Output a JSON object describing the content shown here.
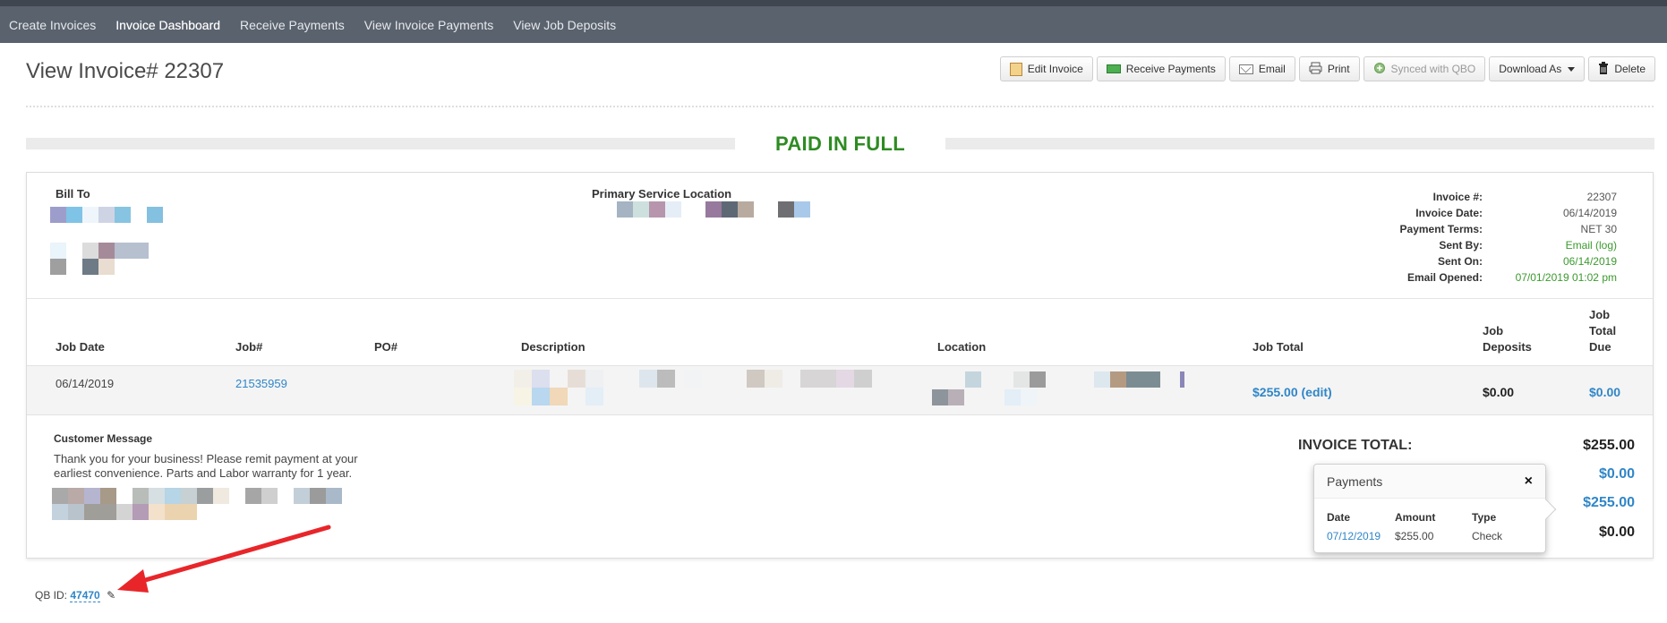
{
  "nav": {
    "items": [
      "Create Invoices",
      "Invoice Dashboard",
      "Receive Payments",
      "View Invoice Payments",
      "View Job Deposits"
    ],
    "active": "Invoice Dashboard"
  },
  "page": {
    "title": "View Invoice# 22307"
  },
  "toolbar": {
    "edit_invoice": "Edit Invoice",
    "receive_payments": "Receive Payments",
    "email": "Email",
    "print": "Print",
    "synced": "Synced with QBO",
    "download_as": "Download As",
    "delete": "Delete"
  },
  "status": {
    "banner": "PAID IN FULL",
    "color": "#2e8b22"
  },
  "bill_to": {
    "label": "Bill To"
  },
  "service_location": {
    "label": "Primary Service Location"
  },
  "invoice_meta": [
    {
      "key": "Invoice #:",
      "value": "22307"
    },
    {
      "key": "Invoice Date:",
      "value": "06/14/2019"
    },
    {
      "key": "Payment Terms:",
      "value": "NET 30"
    },
    {
      "key": "Sent By:",
      "value": "Email (log)"
    },
    {
      "key": "Sent On:",
      "value": "06/14/2019"
    },
    {
      "key": "Email Opened:",
      "value": "07/01/2019 01:02 pm"
    }
  ],
  "job_table": {
    "headers": {
      "job_date": "Job Date",
      "job_no": "Job#",
      "po_no": "PO#",
      "description": "Description",
      "location": "Location",
      "job_total": "Job Total",
      "job_deposits_1": "Job",
      "job_deposits_2": "Deposits",
      "job_total_due_1": "Job",
      "job_total_due_2": "Total",
      "job_total_due_3": "Due"
    },
    "row": {
      "job_date": "06/14/2019",
      "job_no": "21535959",
      "job_total": "$255.00 (edit)",
      "job_deposits": "$0.00",
      "job_total_due": "$0.00"
    }
  },
  "customer_message": {
    "label": "Customer Message",
    "text": "Thank you for your business! Please remit payment at your earliest convenience. Parts and Labor warranty for 1 year."
  },
  "totals": {
    "invoice_total_label": "INVOICE TOTAL:",
    "invoice_total": "$255.00",
    "line2": "$0.00",
    "line3": "$255.00",
    "line4": "$0.00"
  },
  "payments_popover": {
    "title": "Payments",
    "close": "×",
    "headers": {
      "date": "Date",
      "amount": "Amount",
      "type": "Type"
    },
    "row": {
      "date": "07/12/2019",
      "amount": "$255.00",
      "type": "Check"
    }
  },
  "qb": {
    "label": "QB ID:",
    "id": "47470"
  },
  "colors": {
    "link": "#2f86c8",
    "green": "#3b9a2e",
    "annotation_arrow": "#e8262a"
  }
}
